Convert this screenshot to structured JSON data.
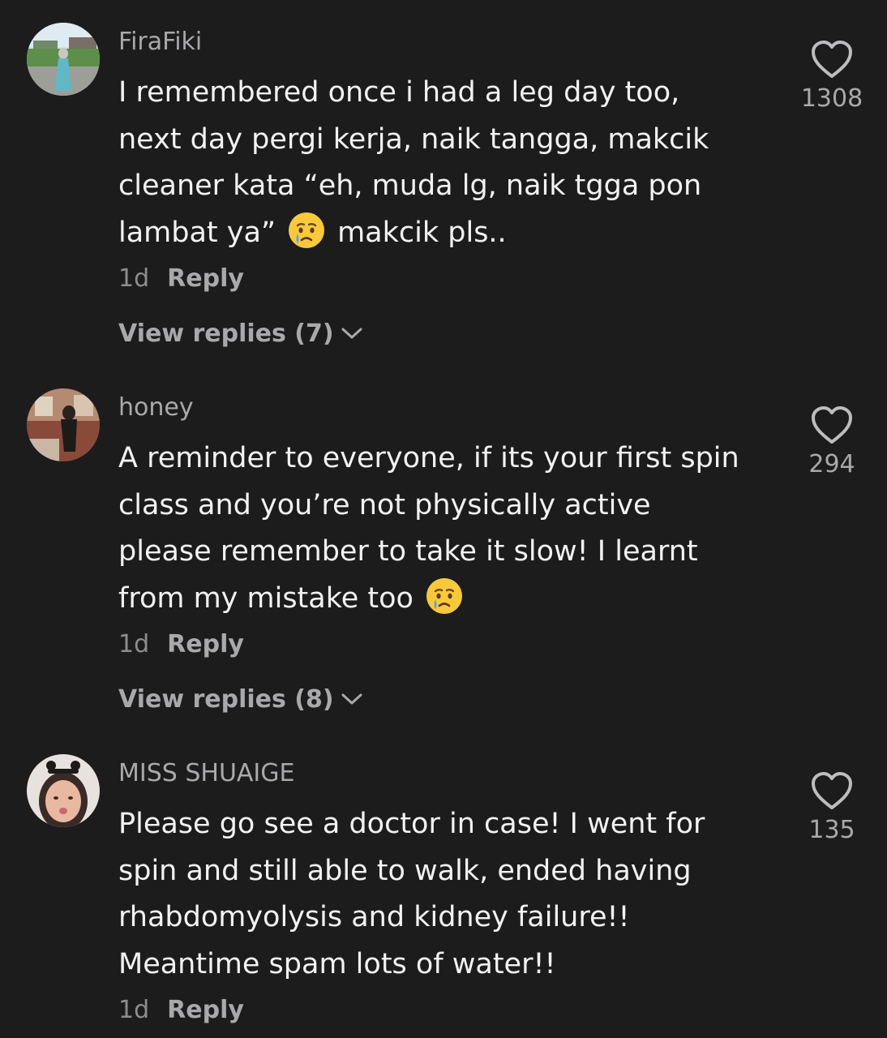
{
  "comments": [
    {
      "username": "FiraFiki",
      "lines": [
        "I remembered once i had a leg day too,",
        "next day pergi kerja, naik tangga, makcik",
        "cleaner kata “eh, muda lg, naik tgga pon"
      ],
      "last_line_before_emoji": "lambat ya”",
      "last_line_after_emoji": "makcik pls..",
      "emoji_icon": "crying-face-emoji",
      "time": "1d",
      "reply_label": "Reply",
      "view_replies": "View replies (7)",
      "like_count": "1308"
    },
    {
      "username": "honey",
      "lines": [
        "A reminder to everyone, if its your first spin",
        "class and you’re not physically active",
        "please remember to take it slow! I learnt"
      ],
      "last_line_before_emoji": "from my mistake too",
      "last_line_after_emoji": "",
      "emoji_icon": "crying-face-emoji",
      "time": "1d",
      "reply_label": "Reply",
      "view_replies": "View replies (8)",
      "like_count": "294"
    },
    {
      "username": "MISS SHUAIGE",
      "lines": [
        "Please go see a doctor in case! I went for",
        "spin and still able to walk, ended having",
        "rhabdomyolysis and kidney failure!!",
        "Meantime spam lots of water!!"
      ],
      "time": "1d",
      "reply_label": "Reply",
      "like_count": "135"
    }
  ],
  "colors": {
    "background": "#1c1c1d",
    "text_primary": "#f2f2f2",
    "text_secondary": "#a9a9ab",
    "emoji_yellow": "#f9c93c",
    "tear_blue": "#4aa8e8"
  }
}
